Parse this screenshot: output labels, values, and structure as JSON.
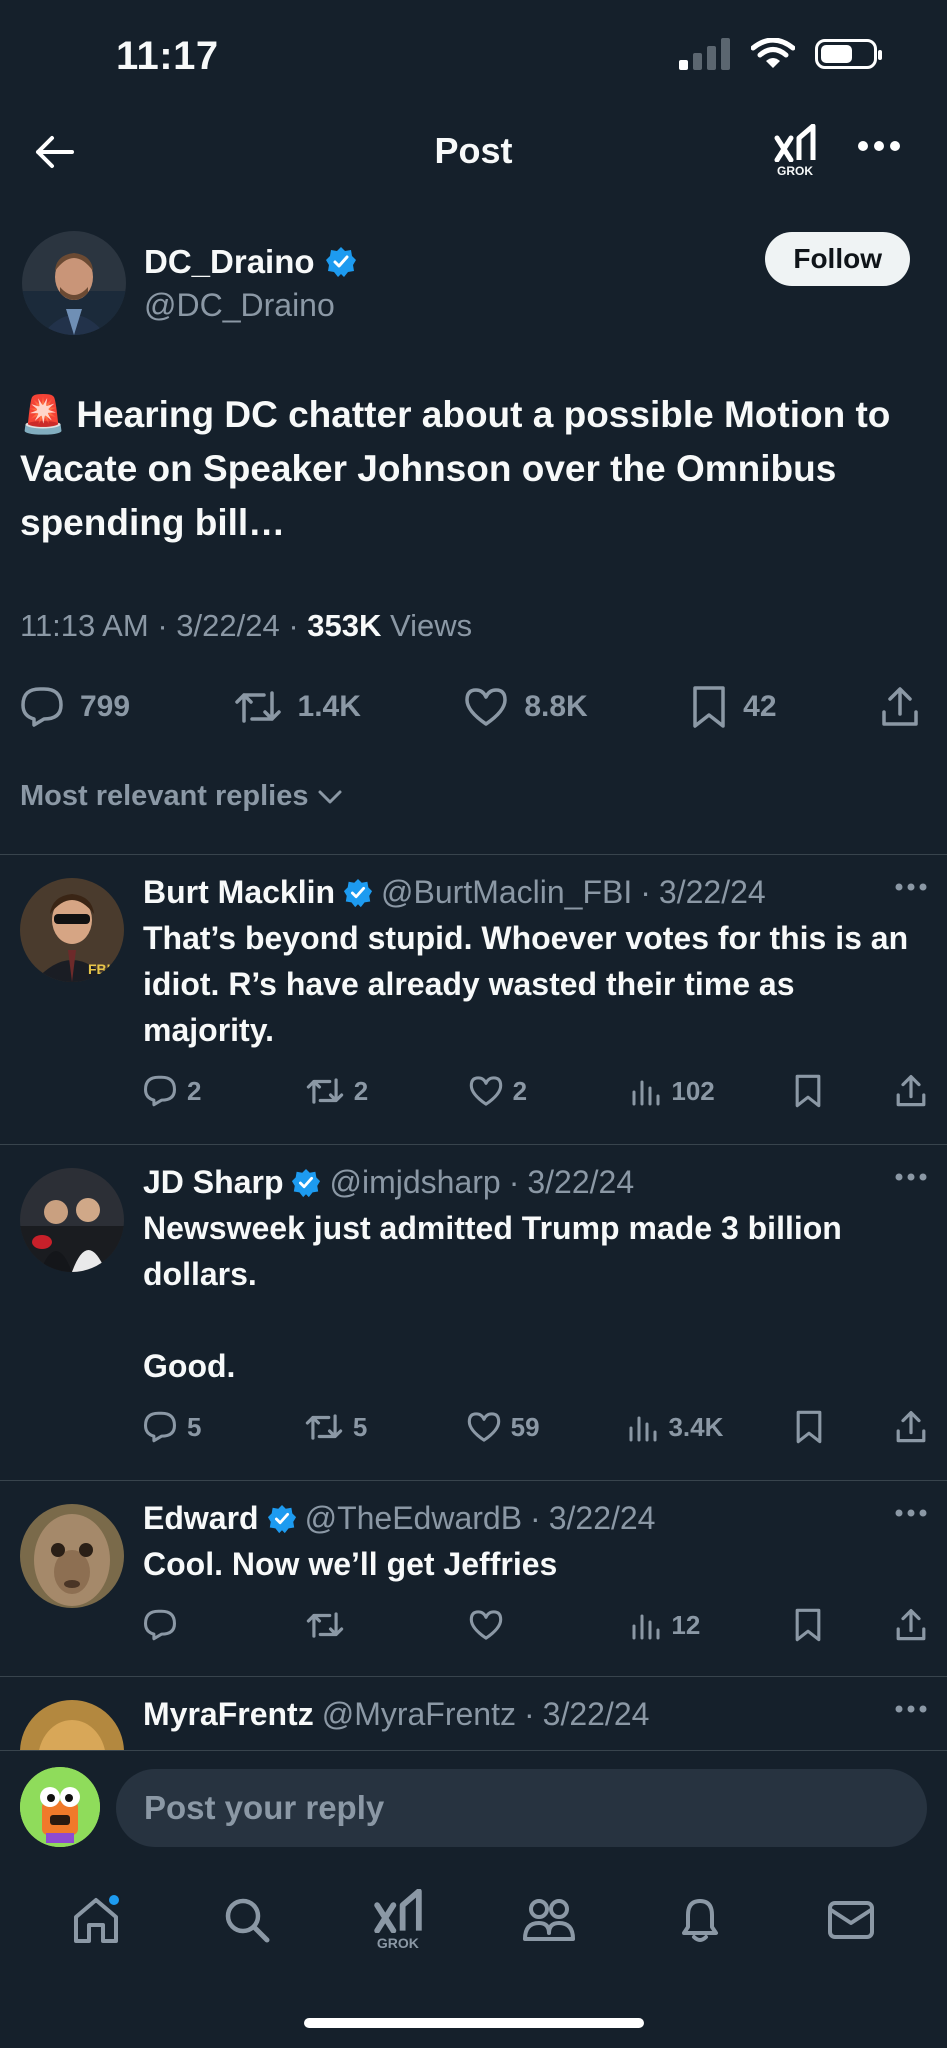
{
  "status": {
    "time": "11:17"
  },
  "nav": {
    "title": "Post",
    "grok_label": "GROK"
  },
  "post": {
    "author_name": "DC_Draino",
    "author_handle": "@DC_Draino",
    "follow_label": "Follow",
    "text": "🚨 Hearing DC chatter about a possible Motion to Vacate on Speaker Johnson over the Omnibus spending bill…",
    "time": "11:13 AM",
    "date": "3/22/24",
    "views_count": "353K",
    "views_label": "Views",
    "replies": "799",
    "reposts": "1.4K",
    "likes": "8.8K",
    "bookmarks": "42"
  },
  "replies_header": "Most relevant replies",
  "replies": [
    {
      "name": "Burt Macklin",
      "handle": "@BurtMaclin_FBI",
      "date": "3/22/24",
      "verified": true,
      "text": "That’s beyond stupid. Whoever votes for this is an idiot. R’s have already wasted their time as majority.",
      "replies": "2",
      "reposts": "2",
      "likes": "2",
      "views": "102"
    },
    {
      "name": "JD Sharp",
      "handle": "@imjdsharp",
      "date": "3/22/24",
      "verified": true,
      "text": "Newsweek just admitted Trump made 3 billion dollars.\n\nGood.",
      "replies": "5",
      "reposts": "5",
      "likes": "59",
      "views": "3.4K"
    },
    {
      "name": "Edward",
      "handle": "@TheEdwardB",
      "date": "3/22/24",
      "verified": true,
      "text": "Cool. Now we’ll get Jeffries",
      "replies": "",
      "reposts": "",
      "likes": "",
      "views": "12"
    },
    {
      "name": "MyraFrentz",
      "handle": "@MyraFrentz",
      "date": "3/22/24",
      "verified": false
    }
  ],
  "composer": {
    "placeholder": "Post your reply"
  },
  "tabs": {
    "grok_label": "GROK"
  },
  "colors": {
    "background": "#15202b",
    "verified": "#1d9bf0",
    "muted": "#8b98a5"
  }
}
